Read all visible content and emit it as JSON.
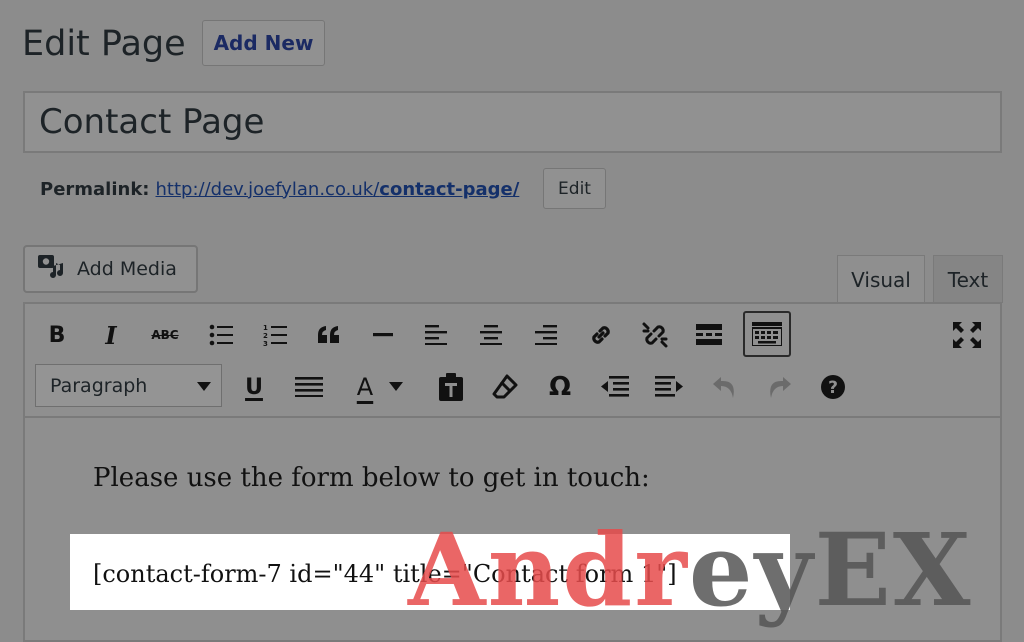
{
  "header": {
    "title": "Edit Page",
    "add_new": "Add New"
  },
  "post": {
    "title": "Contact Page"
  },
  "permalink": {
    "label": "Permalink:",
    "url_base": "http://dev.joefylan.co.uk/",
    "url_slug": "contact-page/",
    "edit_label": "Edit"
  },
  "media": {
    "add_media_label": "Add Media"
  },
  "tabs": {
    "visual": "Visual",
    "text": "Text",
    "active": "visual"
  },
  "toolbar": {
    "format_select": "Paragraph",
    "row1_icons": [
      "bold-icon",
      "italic-icon",
      "strikethrough-icon",
      "bullet-list-icon",
      "numbered-list-icon",
      "blockquote-icon",
      "horizontal-line-icon",
      "align-left-icon",
      "align-center-icon",
      "align-right-icon",
      "link-icon",
      "unlink-icon",
      "read-more-icon",
      "toolbar-toggle-icon",
      "fullscreen-icon"
    ],
    "row2_icons": [
      "underline-icon",
      "justify-icon",
      "text-color-icon",
      "paste-as-text-icon",
      "clear-formatting-icon",
      "special-character-icon",
      "outdent-icon",
      "indent-icon",
      "undo-icon",
      "redo-icon",
      "help-icon"
    ],
    "bold": "B",
    "italic": "I",
    "strike": "ABC",
    "underline": "U",
    "text_color": "A",
    "omega": "Ω",
    "help": "?"
  },
  "content": {
    "paragraph": "Please use the form below to get in touch:",
    "shortcode": "[contact-form-7 id=\"44\" title=\"Contact form 1\"]"
  },
  "watermark": {
    "red_part": "Andr",
    "dark_part": "eyEX"
  },
  "colors": {
    "background": "#8c8c8c",
    "link": "#14306a",
    "watermark_red": "#e74c4c"
  }
}
